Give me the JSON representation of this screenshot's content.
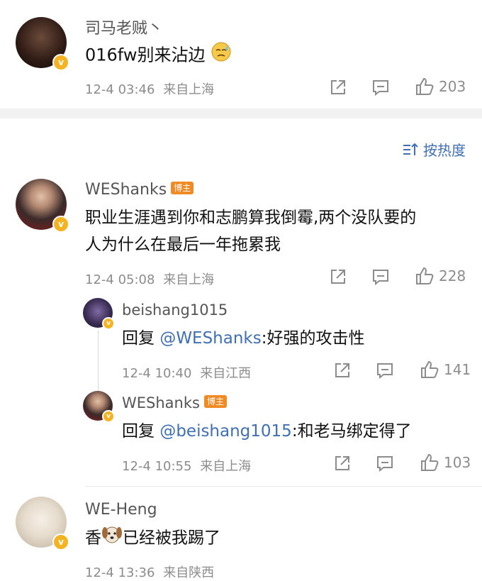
{
  "comments": [
    {
      "name": "司马老贼丶",
      "text": "016fw别来沾边",
      "emoji": "sweat-face",
      "time": "12-4 03:46",
      "location": "来自上海",
      "likes": "203"
    },
    {
      "name": "WEShanks",
      "tag": "博主",
      "text_line1": "职业生涯遇到你和志鹏算我倒霉,两个没队要的",
      "text_line2": "人为什么在最后一年拖累我",
      "time": "12-4 05:08",
      "location": "来自上海",
      "likes": "228"
    },
    {
      "name": "WE-Heng",
      "text_pre": "香",
      "emoji": "dog-face",
      "text_post": "已经被我踢了",
      "time": "12-4 13:36",
      "location": "来自陕西"
    }
  ],
  "replies": [
    {
      "name": "beishang1015",
      "reply_prefix": "回复 ",
      "mention": "@WEShanks",
      "text": ":好强的攻击性",
      "time": "12-4 10:40",
      "location": "来自江西",
      "likes": "141"
    },
    {
      "name": "WEShanks",
      "tag": "博主",
      "reply_prefix": "回复 ",
      "mention": "@beishang1015",
      "text": ":和老马绑定得了",
      "time": "12-4 10:55",
      "location": "来自上海",
      "likes": "103"
    }
  ],
  "sort": {
    "label": "按热度"
  },
  "colors": {
    "accent": "#3f6fb4",
    "verified": "#f5b323",
    "tag": "#f08a24"
  }
}
